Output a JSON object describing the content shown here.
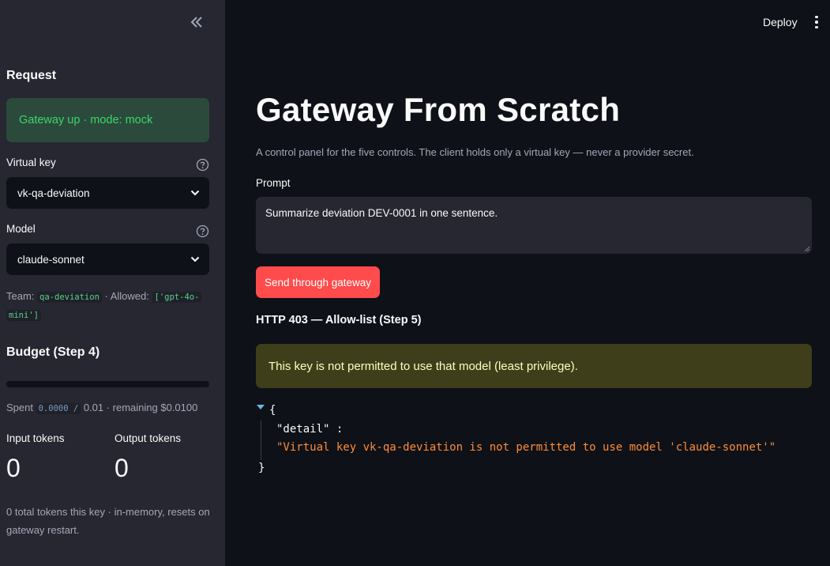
{
  "sidebar": {
    "collapse_icon": "double-chevron-left-icon",
    "request_heading": "Request",
    "status_text": "Gateway up · mode: mock",
    "virtual_key_label": "Virtual key",
    "virtual_key_value": "vk-qa-deviation",
    "model_label": "Model",
    "model_value": "claude-sonnet",
    "team_prefix": "Team:",
    "team_value": "qa-deviation",
    "allowed_prefix": "· Allowed:",
    "allowed_value_1": "['gpt-4o-",
    "allowed_value_2": "mini']",
    "budget_heading": "Budget (Step 4)",
    "budget_progress": 0,
    "spent_prefix": "Spent",
    "spent_code": "0.0000 /",
    "spent_suffix": "0.01 · remaining $0.0100",
    "input_tokens_label": "Input tokens",
    "input_tokens_value": "0",
    "output_tokens_label": "Output tokens",
    "output_tokens_value": "0",
    "caption": "0 total tokens this key · in-memory, resets on gateway restart."
  },
  "header": {
    "deploy_label": "Deploy",
    "menu_icon": "vertical-dots-icon"
  },
  "main": {
    "title": "Gateway From Scratch",
    "subtitle": "A control panel for the five controls. The client holds only a virtual key — never a provider secret.",
    "prompt_label": "Prompt",
    "prompt_value": "Summarize deviation DEV-0001 in one sentence.",
    "send_button": "Send through gateway",
    "response_heading": "HTTP 403 — Allow-list (Step 5)",
    "warning_text": "This key is not permitted to use that model (least privilege).",
    "json_open": "{",
    "json_key": "\"detail\" :",
    "json_value": "\"Virtual key vk-qa-deviation is not permitted to use model 'claude-sonnet'\"",
    "json_close": "}"
  },
  "colors": {
    "accent": "#ff4b4b",
    "success_text": "#3dd56d",
    "warning_text": "#ffffc2",
    "json_string": "#ff8c3a"
  }
}
